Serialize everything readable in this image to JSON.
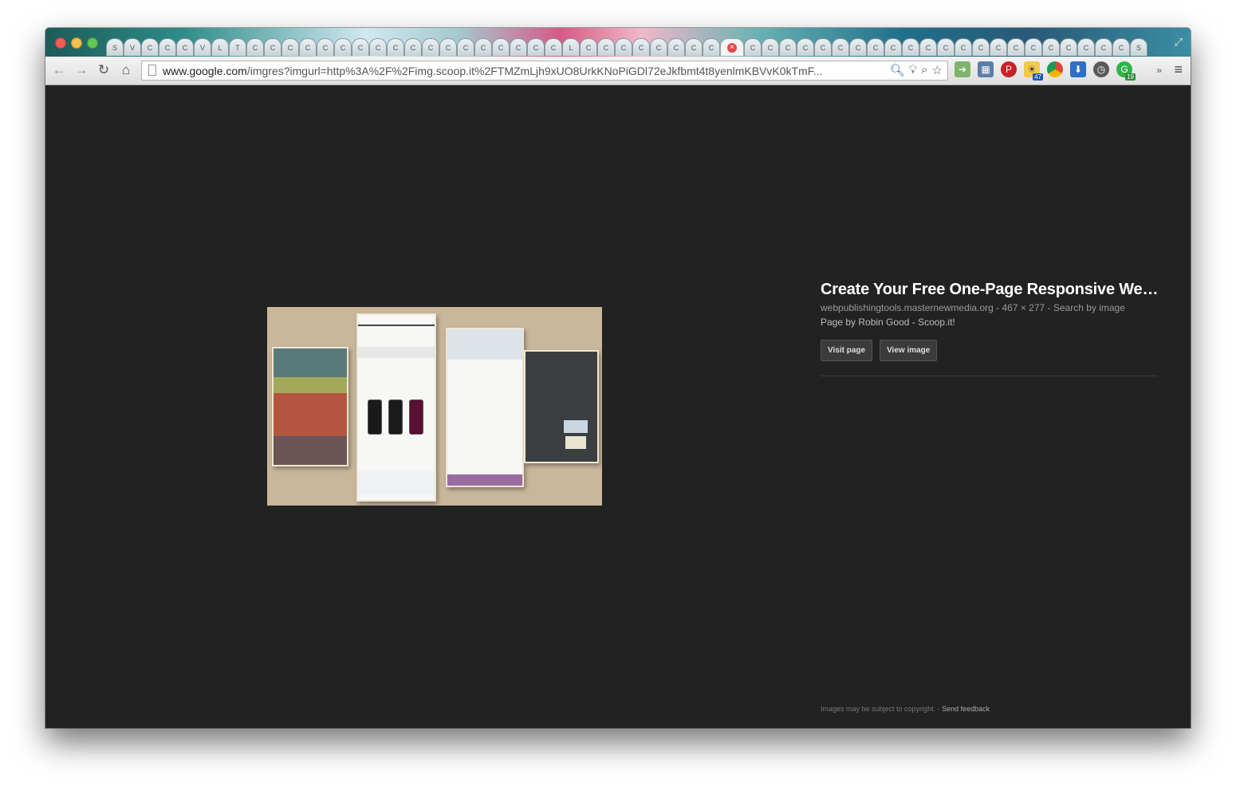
{
  "browser": {
    "url_host": "www.google.com",
    "url_path": "/imgres?imgurl=http%3A%2F%2Fimg.scoop.it%2FTMZmLjh9xUO8UrkKNoPiGDl72eJkfbmt4t8yenlmKBVvK0kTmF...",
    "tab_letters": [
      "S",
      "V",
      "C",
      "C",
      "C",
      "V",
      "L",
      "T",
      "C",
      "C",
      "C",
      "C",
      "C",
      "C",
      "C",
      "C",
      "C",
      "C",
      "C",
      "C",
      "C",
      "C",
      "C",
      "C",
      "C",
      "C",
      "L",
      "C",
      "C",
      "C",
      "C",
      "C",
      "C",
      "C",
      "C",
      "C",
      "C",
      "C",
      "C",
      "C",
      "C",
      "C",
      "C",
      "C",
      "C",
      "C",
      "C",
      "C",
      "C",
      "C",
      "C",
      "C",
      "C",
      "C",
      "C",
      "C",
      "C",
      "C",
      "S"
    ],
    "active_tab_index": 35,
    "extension_badges": {
      "weather": "47",
      "grammarly": "19"
    },
    "overflow_label": "»"
  },
  "result": {
    "title": "Create Your Free One-Page Responsive We…",
    "source": "webpublishingtools.masternewmedia.org",
    "dimensions": "467 × 277",
    "search_by_image": "Search by image",
    "separator": " - ",
    "page_by": "Page by Robin Good - Scoop.it!",
    "visit_page": "Visit page",
    "view_image": "View image"
  },
  "footer": {
    "copyright": "Images may be subject to copyright.",
    "separator": " - ",
    "send_feedback": "Send feedback"
  },
  "colors": {
    "content_bg": "#222222",
    "button_bg": "#3b3b3b",
    "preview_bg": "#c9b79b"
  }
}
